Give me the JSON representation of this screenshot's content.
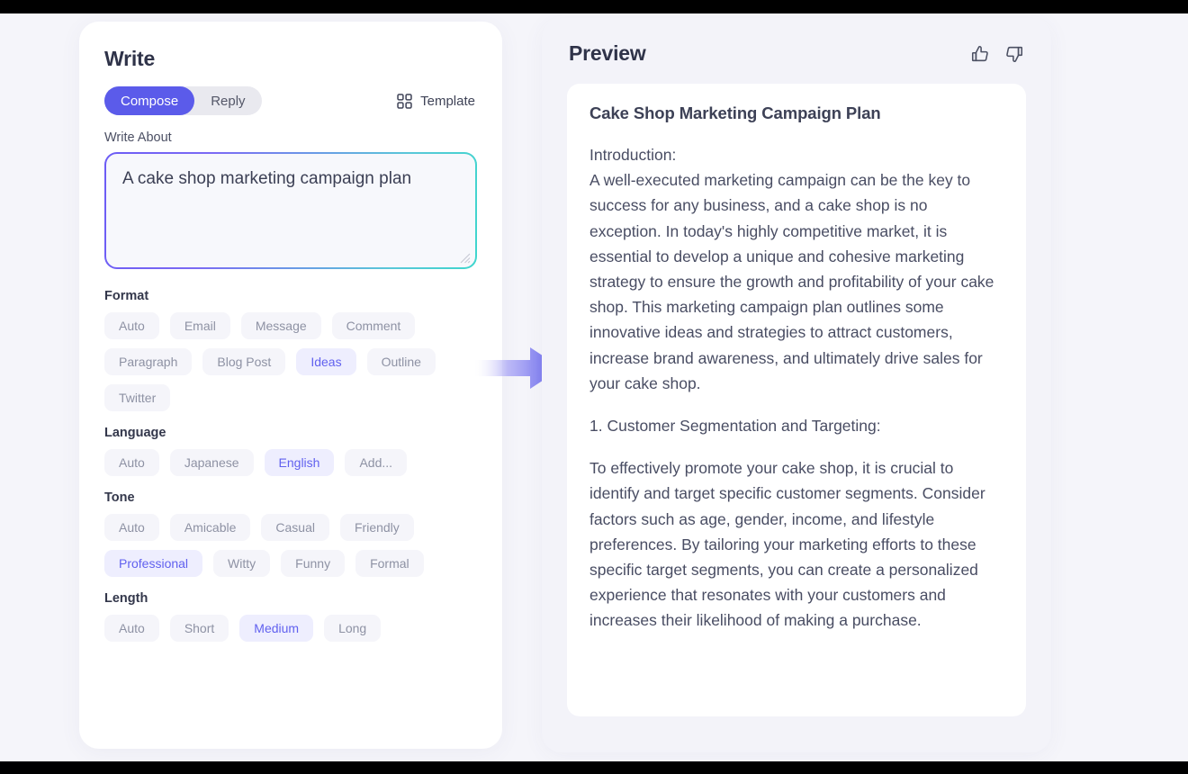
{
  "write": {
    "title": "Write",
    "mode_tabs": [
      {
        "label": "Compose",
        "active": true
      },
      {
        "label": "Reply",
        "active": false
      }
    ],
    "template_button": {
      "label": "Template",
      "icon": "grid-icon"
    },
    "write_about": {
      "label": "Write About",
      "value": "A cake shop marketing campaign plan",
      "placeholder": "Write About"
    },
    "groups": [
      {
        "key": "format",
        "title": "Format",
        "chips": [
          {
            "label": "Auto",
            "selected": false
          },
          {
            "label": "Email",
            "selected": false
          },
          {
            "label": "Message",
            "selected": false
          },
          {
            "label": "Comment",
            "selected": false
          },
          {
            "label": "Paragraph",
            "selected": false
          },
          {
            "label": "Blog Post",
            "selected": false
          },
          {
            "label": "Ideas",
            "selected": true
          },
          {
            "label": "Outline",
            "selected": false
          },
          {
            "label": "Twitter",
            "selected": false
          }
        ]
      },
      {
        "key": "language",
        "title": "Language",
        "chips": [
          {
            "label": "Auto",
            "selected": false
          },
          {
            "label": "Japanese",
            "selected": false
          },
          {
            "label": "English",
            "selected": true
          },
          {
            "label": "Add...",
            "selected": false
          }
        ]
      },
      {
        "key": "tone",
        "title": "Tone",
        "chips": [
          {
            "label": "Auto",
            "selected": false
          },
          {
            "label": "Amicable",
            "selected": false
          },
          {
            "label": "Casual",
            "selected": false
          },
          {
            "label": "Friendly",
            "selected": false
          },
          {
            "label": "Professional",
            "selected": true
          },
          {
            "label": "Witty",
            "selected": false
          },
          {
            "label": "Funny",
            "selected": false
          },
          {
            "label": "Formal",
            "selected": false
          }
        ]
      },
      {
        "key": "length",
        "title": "Length",
        "chips": [
          {
            "label": "Auto",
            "selected": false
          },
          {
            "label": "Short",
            "selected": false
          },
          {
            "label": "Medium",
            "selected": true
          },
          {
            "label": "Long",
            "selected": false
          }
        ]
      }
    ]
  },
  "preview": {
    "title": "Preview",
    "actions": [
      {
        "name": "thumbs-up-icon",
        "label": "Thumbs up"
      },
      {
        "name": "thumbs-down-icon",
        "label": "Thumbs down"
      }
    ],
    "document": {
      "title": "Cake Shop Marketing Campaign Plan",
      "paragraphs": [
        "Introduction:\nA well-executed marketing campaign can be the key to success for any business, and a cake shop is no exception. In today's highly competitive market, it is essential to develop a unique and cohesive marketing strategy to ensure the growth and profitability of your cake shop. This marketing campaign plan outlines some innovative ideas and strategies to attract customers, increase brand awareness, and ultimately drive sales for your cake shop.",
        "1. Customer Segmentation and Targeting:",
        "To effectively promote your cake shop, it is crucial to identify and target specific customer segments. Consider factors such as age, gender, income, and lifestyle preferences. By tailoring your marketing efforts to these specific target segments, you can create a personalized experience that resonates with your customers and increases their likelihood of making a purchase."
      ]
    }
  },
  "flow": {
    "arrow": "right-arrow-icon"
  },
  "colors": {
    "accent": "#5b5bea",
    "accent_soft_bg": "#eeeefe",
    "accent_text": "#6161ef",
    "page_bg": "#f5f5fa",
    "panel_bg": "#ffffff",
    "preview_bg": "#f3f3f9",
    "chip_bg": "#f5f5fa",
    "chip_text": "#8e92a4",
    "heading": "#2f3349",
    "body_text": "#494d63",
    "gradient_start": "#6c5cf5",
    "gradient_end": "#3fd6cd"
  }
}
